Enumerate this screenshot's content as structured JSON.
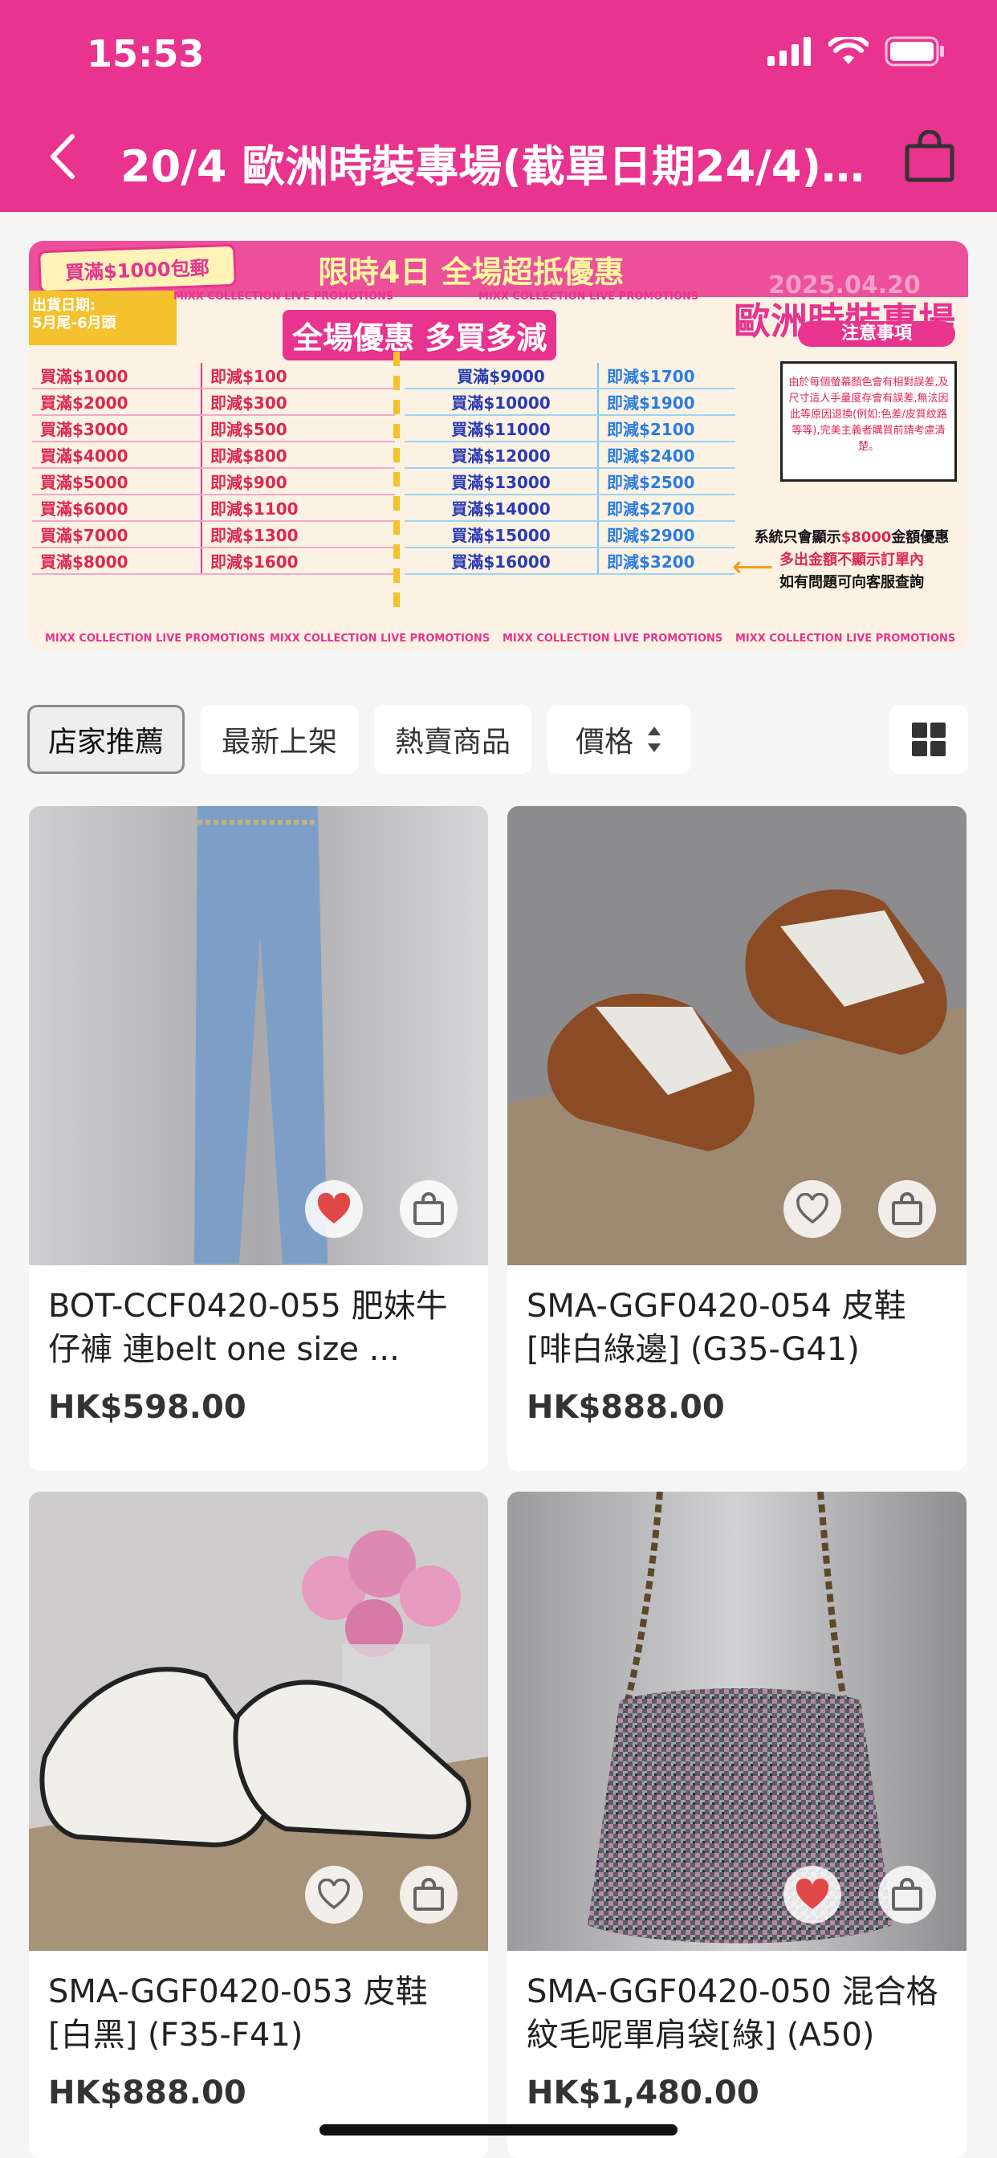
{
  "status_bar": {
    "time": "15:53"
  },
  "nav": {
    "title": "20/4 歐洲時裝專場(截單日期24/4)..."
  },
  "banner": {
    "free_shipping": "買滿$1000包郵",
    "headline": "限時4日  全場超抵優惠",
    "ship_label": "出貨日期:",
    "ship_date": "5月尾-6月頭",
    "watermark": "MIXX COLLECTION LIVE PROMOTIONS",
    "subheadline": "全場優惠 多買多減",
    "event_date": "2025.04.20",
    "event_name": "歐洲時裝專場",
    "tiers_left": [
      [
        "買滿$1000",
        "即減$100"
      ],
      [
        "買滿$2000",
        "即減$300"
      ],
      [
        "買滿$3000",
        "即減$500"
      ],
      [
        "買滿$4000",
        "即減$800"
      ],
      [
        "買滿$5000",
        "即減$900"
      ],
      [
        "買滿$6000",
        "即減$1100"
      ],
      [
        "買滿$7000",
        "即減$1300"
      ],
      [
        "買滿$8000",
        "即減$1600"
      ]
    ],
    "tiers_right": [
      [
        "買滿$9000",
        "即減$1700"
      ],
      [
        "買滿$10000",
        "即減$1900"
      ],
      [
        "買滿$11000",
        "即減$2100"
      ],
      [
        "買滿$12000",
        "即減$2400"
      ],
      [
        "買滿$13000",
        "即減$2500"
      ],
      [
        "買滿$14000",
        "即減$2700"
      ],
      [
        "買滿$15000",
        "即減$2900"
      ],
      [
        "買滿$16000",
        "即減$3200"
      ]
    ],
    "notice_title": "注意事項",
    "notice_text": "由於每個螢幕顏色會有相對誤差,及尺寸這人手量度存會有誤差,無法因此等原因退換(例如:色差/皮質紋路等等),完美主義者購買前請考慮清楚。",
    "note_line1_a": "系統只會顯示",
    "note_line1_b": "$8000",
    "note_line1_c": "金額優惠",
    "note_line2": "多出金額不顯示訂單內",
    "note_line3": "如有問題可向客服查詢"
  },
  "filters": {
    "recommended": "店家推薦",
    "newest": "最新上架",
    "hot": "熱賣商品",
    "price": "價格"
  },
  "products": [
    {
      "title": "BOT-CCF0420-055 肥妹牛仔褲 連belt one size ...",
      "price": "HK$598.00",
      "favorited": true
    },
    {
      "title": "SMA-GGF0420-054 皮鞋[啡白綠邊] (G35-G41)",
      "price": "HK$888.00",
      "favorited": false
    },
    {
      "title": "SMA-GGF0420-053 皮鞋[白黑] (F35-F41)",
      "price": "HK$888.00",
      "favorited": false
    },
    {
      "title": "SMA-GGF0420-050 混合格紋毛呢單肩袋[綠] (A50)",
      "price": "HK$1,480.00",
      "favorited": true
    }
  ],
  "colors": {
    "brand": "#e8338f",
    "favorite": "#e04848"
  }
}
